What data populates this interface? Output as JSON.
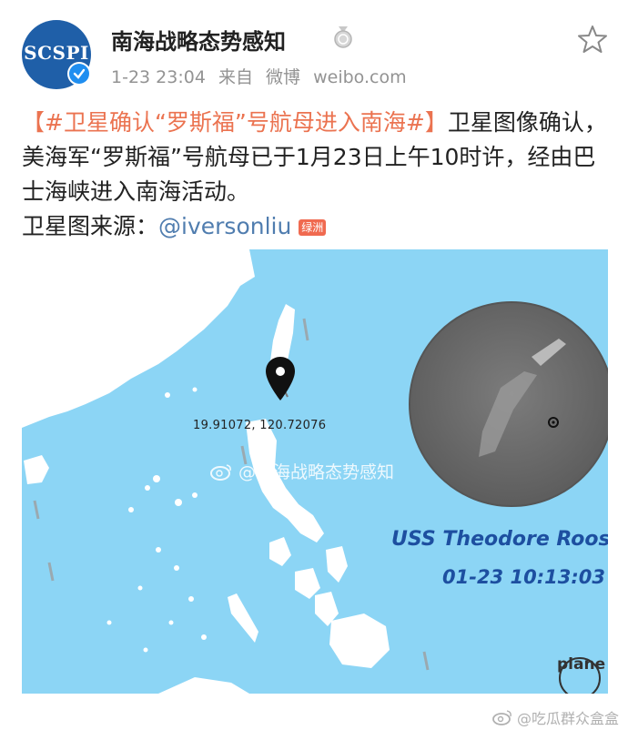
{
  "author": {
    "avatar_text": "SCSPI",
    "name": "南海战略态势感知"
  },
  "meta": {
    "time": "1-23 23:04",
    "source_prefix": "来自",
    "source_name": "微博",
    "source_domain": "weibo.com"
  },
  "post": {
    "bracket_open": "【",
    "topic": "#卫星确认“罗斯福”号航母进入南海#",
    "bracket_close": "】",
    "body": "卫星图像确认，美海军“罗斯福”号航母已于1月23日上午10时许，经由巴士海峡进入南海活动。",
    "source_label": "卫星图来源：",
    "mention": "@iversonliu",
    "mention_badge": "绿洲"
  },
  "image": {
    "coordinates": "19.91072, 120.72076",
    "watermark": "@南海战略态势感知",
    "ship_name": "USS Theodore Roosev",
    "timestamp": "01-23 10:13:03",
    "brand": "plane"
  },
  "footer_watermark": "@吃瓜群众盒盒",
  "colors": {
    "link": "#eb7350",
    "mention": "#507daf",
    "sea": "#8cd5f5",
    "land": "#ffffff"
  }
}
